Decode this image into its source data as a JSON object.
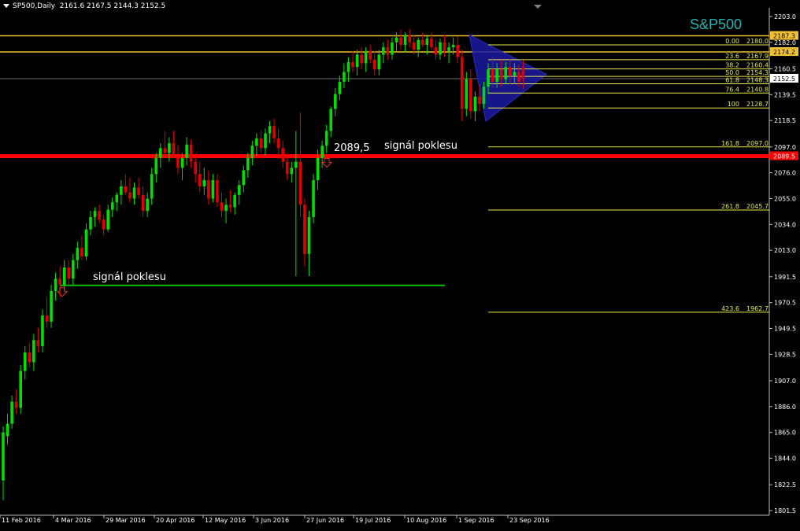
{
  "header": {
    "symbol": "SP500,Daily",
    "ohlc": "2161.6 2167.5 2144.3 2152.5"
  },
  "brand_label": "S&P500",
  "colors": {
    "background": "#000000",
    "bull": "#00e000",
    "bear": "#e00000",
    "axis_text": "#ffffff",
    "fib": "#e8e84a",
    "gold_line": "#f0c030",
    "support_red": "#ff0000",
    "support_green": "#00c000",
    "triangle": "#1a1aa0",
    "brand": "#1fb2b2"
  },
  "chart_data": {
    "type": "candlestick",
    "title": "SP500,Daily",
    "y_range": [
      1801.5,
      2203.0
    ],
    "y_ticks": [
      "2203.0",
      "2182.0",
      "2160.5",
      "2139.5",
      "2118.5",
      "2097.0",
      "2076.0",
      "2055.0",
      "2034.0",
      "2013.0",
      "1991.5",
      "1970.5",
      "1949.5",
      "1928.5",
      "1907.0",
      "1886.0",
      "1865.0",
      "1844.0",
      "1822.5",
      "1801.5"
    ],
    "x_ticks": [
      "11 Feb 2016",
      "4 Mar 2016",
      "29 Mar 2016",
      "20 Apr 2016",
      "12 May 2016",
      "3 Jun 2016",
      "27 Jun 2016",
      "19 Jul 2016",
      "10 Aug 2016",
      "1 Sep 2016",
      "23 Sep 2016"
    ],
    "price_labels": [
      {
        "text": "2187.3",
        "value": 2187.3,
        "style": "gold"
      },
      {
        "text": "2174.2",
        "value": 2174.2,
        "style": "gold"
      },
      {
        "text": "2152.5",
        "value": 2152.5,
        "style": "current"
      },
      {
        "text": "2089.5",
        "value": 2089.5,
        "style": "red"
      }
    ],
    "fibonacci_levels": [
      {
        "level": "0.00",
        "price": "2180.0",
        "value": 2180.0
      },
      {
        "level": "23.6",
        "price": "2167.9",
        "value": 2167.9
      },
      {
        "level": "38.2",
        "price": "2160.4",
        "value": 2160.4
      },
      {
        "level": "50.0",
        "price": "2154.3",
        "value": 2154.3
      },
      {
        "level": "61.8",
        "price": "2148.3",
        "value": 2148.3
      },
      {
        "level": "76.4",
        "price": "2140.8",
        "value": 2140.8
      },
      {
        "level": "100",
        "price": "2128.7",
        "value": 2128.7
      },
      {
        "level": "161.8",
        "price": "2097.0",
        "value": 2097.0
      },
      {
        "level": "261.8",
        "price": "2045.7",
        "value": 2045.7
      },
      {
        "level": "423.6",
        "price": "1962.7",
        "value": 1962.7
      }
    ],
    "horizontal_lines": [
      {
        "value": 2187.3,
        "color": "gold"
      },
      {
        "value": 2174.2,
        "color": "gold"
      },
      {
        "value": 2152.5,
        "color": "gray"
      },
      {
        "value": 2089.5,
        "color": "red"
      }
    ],
    "support_green": {
      "value": 1984.5,
      "from_date": "4 Mar 2016",
      "to_date": "19 Jul 2016"
    },
    "annotations": [
      {
        "text": "2089,5",
        "value": 2097.0,
        "date": "27 Jun 2016"
      },
      {
        "text": "signál poklesu",
        "value": 2097.0,
        "date": "19 Jul 2016"
      },
      {
        "text": "signál poklesu",
        "value": 1991.5,
        "date": "4 Mar 2016"
      }
    ],
    "candles": [
      {
        "o": 1826,
        "h": 1870,
        "l": 1810,
        "c": 1865
      },
      {
        "o": 1862,
        "h": 1880,
        "l": 1855,
        "c": 1872
      },
      {
        "o": 1872,
        "h": 1895,
        "l": 1868,
        "c": 1890
      },
      {
        "o": 1890,
        "h": 1900,
        "l": 1880,
        "c": 1885
      },
      {
        "o": 1885,
        "h": 1920,
        "l": 1880,
        "c": 1915
      },
      {
        "o": 1915,
        "h": 1935,
        "l": 1908,
        "c": 1930
      },
      {
        "o": 1930,
        "h": 1938,
        "l": 1918,
        "c": 1922
      },
      {
        "o": 1922,
        "h": 1945,
        "l": 1915,
        "c": 1940
      },
      {
        "o": 1940,
        "h": 1950,
        "l": 1930,
        "c": 1935
      },
      {
        "o": 1935,
        "h": 1965,
        "l": 1930,
        "c": 1960
      },
      {
        "o": 1960,
        "h": 1975,
        "l": 1950,
        "c": 1955
      },
      {
        "o": 1955,
        "h": 1985,
        "l": 1950,
        "c": 1980
      },
      {
        "o": 1980,
        "h": 1995,
        "l": 1972,
        "c": 1990
      },
      {
        "o": 1990,
        "h": 2000,
        "l": 1975,
        "c": 1985
      },
      {
        "o": 1985,
        "h": 2005,
        "l": 1980,
        "c": 1999
      },
      {
        "o": 1999,
        "h": 2005,
        "l": 1985,
        "c": 1990
      },
      {
        "o": 1990,
        "h": 2010,
        "l": 1985,
        "c": 2005
      },
      {
        "o": 2005,
        "h": 2020,
        "l": 1998,
        "c": 2015
      },
      {
        "o": 2015,
        "h": 2025,
        "l": 2005,
        "c": 2008
      },
      {
        "o": 2008,
        "h": 2035,
        "l": 2005,
        "c": 2030
      },
      {
        "o": 2030,
        "h": 2045,
        "l": 2025,
        "c": 2040
      },
      {
        "o": 2040,
        "h": 2048,
        "l": 2032,
        "c": 2045
      },
      {
        "o": 2045,
        "h": 2050,
        "l": 2035,
        "c": 2038
      },
      {
        "o": 2038,
        "h": 2042,
        "l": 2025,
        "c": 2030
      },
      {
        "o": 2030,
        "h": 2050,
        "l": 2028,
        "c": 2046
      },
      {
        "o": 2046,
        "h": 2056,
        "l": 2040,
        "c": 2052
      },
      {
        "o": 2052,
        "h": 2060,
        "l": 2045,
        "c": 2058
      },
      {
        "o": 2058,
        "h": 2070,
        "l": 2050,
        "c": 2065
      },
      {
        "o": 2065,
        "h": 2075,
        "l": 2058,
        "c": 2060
      },
      {
        "o": 2060,
        "h": 2072,
        "l": 2052,
        "c": 2055
      },
      {
        "o": 2055,
        "h": 2068,
        "l": 2050,
        "c": 2064
      },
      {
        "o": 2064,
        "h": 2072,
        "l": 2055,
        "c": 2058
      },
      {
        "o": 2058,
        "h": 2065,
        "l": 2040,
        "c": 2045
      },
      {
        "o": 2045,
        "h": 2060,
        "l": 2040,
        "c": 2055
      },
      {
        "o": 2055,
        "h": 2080,
        "l": 2050,
        "c": 2075
      },
      {
        "o": 2075,
        "h": 2092,
        "l": 2068,
        "c": 2088
      },
      {
        "o": 2088,
        "h": 2100,
        "l": 2080,
        "c": 2096
      },
      {
        "o": 2096,
        "h": 2110,
        "l": 2088,
        "c": 2092
      },
      {
        "o": 2092,
        "h": 2105,
        "l": 2085,
        "c": 2100
      },
      {
        "o": 2100,
        "h": 2110,
        "l": 2088,
        "c": 2090
      },
      {
        "o": 2090,
        "h": 2098,
        "l": 2075,
        "c": 2080
      },
      {
        "o": 2080,
        "h": 2092,
        "l": 2070,
        "c": 2088
      },
      {
        "o": 2088,
        "h": 2105,
        "l": 2082,
        "c": 2099
      },
      {
        "o": 2099,
        "h": 2103,
        "l": 2080,
        "c": 2085
      },
      {
        "o": 2085,
        "h": 2092,
        "l": 2068,
        "c": 2075
      },
      {
        "o": 2075,
        "h": 2085,
        "l": 2060,
        "c": 2065
      },
      {
        "o": 2065,
        "h": 2080,
        "l": 2058,
        "c": 2070
      },
      {
        "o": 2070,
        "h": 2078,
        "l": 2050,
        "c": 2055
      },
      {
        "o": 2055,
        "h": 2075,
        "l": 2052,
        "c": 2070
      },
      {
        "o": 2070,
        "h": 2075,
        "l": 2048,
        "c": 2052
      },
      {
        "o": 2052,
        "h": 2060,
        "l": 2040,
        "c": 2045
      },
      {
        "o": 2045,
        "h": 2055,
        "l": 2035,
        "c": 2050
      },
      {
        "o": 2050,
        "h": 2062,
        "l": 2044,
        "c": 2048
      },
      {
        "o": 2048,
        "h": 2060,
        "l": 2042,
        "c": 2058
      },
      {
        "o": 2058,
        "h": 2070,
        "l": 2050,
        "c": 2066
      },
      {
        "o": 2066,
        "h": 2082,
        "l": 2060,
        "c": 2078
      },
      {
        "o": 2078,
        "h": 2092,
        "l": 2072,
        "c": 2088
      },
      {
        "o": 2088,
        "h": 2102,
        "l": 2082,
        "c": 2098
      },
      {
        "o": 2098,
        "h": 2108,
        "l": 2090,
        "c": 2104
      },
      {
        "o": 2104,
        "h": 2110,
        "l": 2092,
        "c": 2096
      },
      {
        "o": 2096,
        "h": 2112,
        "l": 2090,
        "c": 2108
      },
      {
        "o": 2108,
        "h": 2118,
        "l": 2100,
        "c": 2114
      },
      {
        "o": 2114,
        "h": 2120,
        "l": 2100,
        "c": 2104
      },
      {
        "o": 2104,
        "h": 2112,
        "l": 2090,
        "c": 2096
      },
      {
        "o": 2096,
        "h": 2102,
        "l": 2080,
        "c": 2085
      },
      {
        "o": 2085,
        "h": 2092,
        "l": 2070,
        "c": 2075
      },
      {
        "o": 2075,
        "h": 2085,
        "l": 2068,
        "c": 2080
      },
      {
        "o": 2080,
        "h": 2110,
        "l": 1992,
        "c": 2085
      },
      {
        "o": 2085,
        "h": 2125,
        "l": 2040,
        "c": 2050
      },
      {
        "o": 2050,
        "h": 2055,
        "l": 2000,
        "c": 2010
      },
      {
        "o": 2010,
        "h": 2045,
        "l": 1992,
        "c": 2040
      },
      {
        "o": 2040,
        "h": 2075,
        "l": 2035,
        "c": 2070
      },
      {
        "o": 2070,
        "h": 2095,
        "l": 2062,
        "c": 2088
      },
      {
        "o": 2088,
        "h": 2102,
        "l": 2080,
        "c": 2098
      },
      {
        "o": 2098,
        "h": 2115,
        "l": 2092,
        "c": 2110
      },
      {
        "o": 2110,
        "h": 2130,
        "l": 2105,
        "c": 2128
      },
      {
        "o": 2128,
        "h": 2145,
        "l": 2122,
        "c": 2140
      },
      {
        "o": 2140,
        "h": 2155,
        "l": 2135,
        "c": 2150
      },
      {
        "o": 2150,
        "h": 2165,
        "l": 2145,
        "c": 2158
      },
      {
        "o": 2158,
        "h": 2170,
        "l": 2150,
        "c": 2166
      },
      {
        "o": 2166,
        "h": 2175,
        "l": 2158,
        "c": 2162
      },
      {
        "o": 2162,
        "h": 2176,
        "l": 2155,
        "c": 2172
      },
      {
        "o": 2172,
        "h": 2178,
        "l": 2160,
        "c": 2165
      },
      {
        "o": 2165,
        "h": 2178,
        "l": 2158,
        "c": 2175
      },
      {
        "o": 2175,
        "h": 2180,
        "l": 2165,
        "c": 2168
      },
      {
        "o": 2168,
        "h": 2175,
        "l": 2155,
        "c": 2160
      },
      {
        "o": 2160,
        "h": 2176,
        "l": 2155,
        "c": 2172
      },
      {
        "o": 2172,
        "h": 2182,
        "l": 2165,
        "c": 2178
      },
      {
        "o": 2178,
        "h": 2184,
        "l": 2168,
        "c": 2172
      },
      {
        "o": 2172,
        "h": 2186,
        "l": 2168,
        "c": 2182
      },
      {
        "o": 2182,
        "h": 2190,
        "l": 2175,
        "c": 2186
      },
      {
        "o": 2186,
        "h": 2192,
        "l": 2176,
        "c": 2180
      },
      {
        "o": 2180,
        "h": 2190,
        "l": 2174,
        "c": 2188
      },
      {
        "o": 2188,
        "h": 2193,
        "l": 2178,
        "c": 2182
      },
      {
        "o": 2182,
        "h": 2188,
        "l": 2172,
        "c": 2176
      },
      {
        "o": 2176,
        "h": 2186,
        "l": 2170,
        "c": 2184
      },
      {
        "o": 2184,
        "h": 2190,
        "l": 2178,
        "c": 2180
      },
      {
        "o": 2180,
        "h": 2187,
        "l": 2172,
        "c": 2185
      },
      {
        "o": 2185,
        "h": 2190,
        "l": 2176,
        "c": 2178
      },
      {
        "o": 2178,
        "h": 2184,
        "l": 2168,
        "c": 2172
      },
      {
        "o": 2172,
        "h": 2185,
        "l": 2168,
        "c": 2182
      },
      {
        "o": 2182,
        "h": 2188,
        "l": 2170,
        "c": 2175
      },
      {
        "o": 2175,
        "h": 2182,
        "l": 2165,
        "c": 2178
      },
      {
        "o": 2178,
        "h": 2186,
        "l": 2172,
        "c": 2180
      },
      {
        "o": 2180,
        "h": 2187,
        "l": 2165,
        "c": 2170
      },
      {
        "o": 2170,
        "h": 2176,
        "l": 2118,
        "c": 2128
      },
      {
        "o": 2128,
        "h": 2158,
        "l": 2122,
        "c": 2152
      },
      {
        "o": 2152,
        "h": 2160,
        "l": 2120,
        "c": 2126
      },
      {
        "o": 2126,
        "h": 2142,
        "l": 2118,
        "c": 2138
      },
      {
        "o": 2138,
        "h": 2148,
        "l": 2126,
        "c": 2132
      },
      {
        "o": 2132,
        "h": 2150,
        "l": 2128,
        "c": 2146
      },
      {
        "o": 2146,
        "h": 2165,
        "l": 2140,
        "c": 2160
      },
      {
        "o": 2160,
        "h": 2170,
        "l": 2145,
        "c": 2150
      },
      {
        "o": 2150,
        "h": 2165,
        "l": 2145,
        "c": 2160
      },
      {
        "o": 2160,
        "h": 2168,
        "l": 2146,
        "c": 2152
      },
      {
        "o": 2152,
        "h": 2166,
        "l": 2148,
        "c": 2162
      },
      {
        "o": 2162,
        "h": 2168,
        "l": 2148,
        "c": 2155
      },
      {
        "o": 2155,
        "h": 2165,
        "l": 2148,
        "c": 2158
      },
      {
        "o": 2158,
        "h": 2164,
        "l": 2146,
        "c": 2150
      },
      {
        "o": 2161.6,
        "h": 2167.5,
        "l": 2144.3,
        "c": 2152.5
      }
    ]
  }
}
